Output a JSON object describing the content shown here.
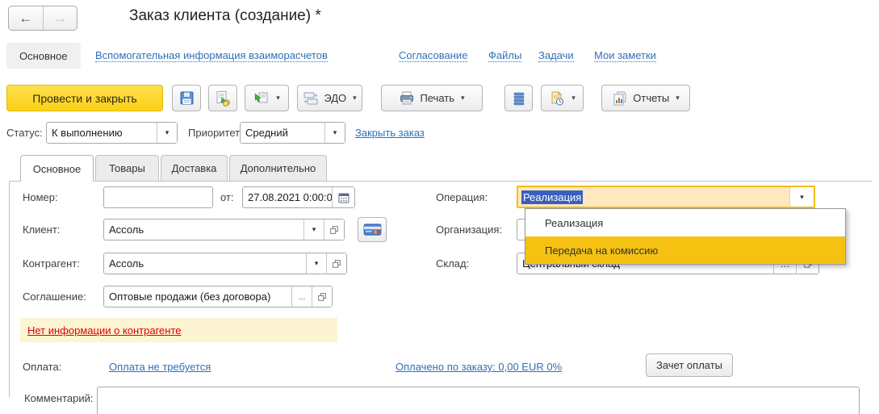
{
  "window": {
    "title": "Заказ клиента (создание) *"
  },
  "nav": {
    "active": "Основное",
    "links": [
      "Вспомогательная информация взаиморасчетов",
      "Согласование",
      "Файлы",
      "Задачи",
      "Мои заметки"
    ]
  },
  "toolbar": {
    "post_close": "Провести и закрыть",
    "edo": "ЭДО",
    "print": "Печать",
    "reports": "Отчеты"
  },
  "status_row": {
    "status_label": "Статус:",
    "status_value": "К выполнению",
    "priority_label": "Приоритет:",
    "priority_value": "Средний",
    "close_order_link": "Закрыть заказ"
  },
  "tabs": {
    "items": [
      "Основное",
      "Товары",
      "Доставка",
      "Дополнительно"
    ],
    "active": "Основное"
  },
  "form": {
    "number_label": "Номер:",
    "date_label": "от:",
    "date_value": "27.08.2021  0:00:00",
    "operation_label": "Операция:",
    "operation_value": "Реализация",
    "client_label": "Клиент:",
    "client_value": "Ассоль",
    "org_label": "Организация:",
    "counterparty_label": "Контрагент:",
    "counterparty_value": "Ассоль",
    "warehouse_label": "Склад:",
    "warehouse_value": "Центральный склад",
    "agreement_label": "Соглашение:",
    "agreement_value": "Оптовые продажи (без договора)",
    "warning_link": "Нет информации о контрагенте",
    "payment_label": "Оплата:",
    "payment_link1": "Оплата не требуется",
    "payment_link2": "Оплачено по заказу: 0,00 EUR 0%",
    "payment_button": "Зачет оплаты",
    "comment_label": "Комментарий:"
  },
  "dropdown": {
    "options": [
      "Реализация",
      "Передача на комиссию"
    ],
    "highlighted": "Передача на комиссию"
  },
  "icons": {
    "back": "←",
    "forward": "→",
    "dropdown_arrow": "▾",
    "ellipsis": "…"
  },
  "colors": {
    "accent_yellow_button": "#fcd017",
    "focus_border": "#f1be16",
    "dropdown_highlight": "#f5c211",
    "selection_blue": "#3a5fc0",
    "operation_field_bg": "#fde8c0",
    "warning_bg": "#fcf4d2",
    "warning_link": "#e00000",
    "link_blue": "#2e70b8"
  }
}
